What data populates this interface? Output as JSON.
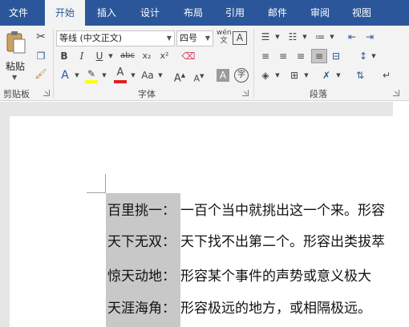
{
  "tabs": [
    {
      "label": "文件",
      "active": false
    },
    {
      "label": "开始",
      "active": true
    },
    {
      "label": "插入",
      "active": false
    },
    {
      "label": "设计",
      "active": false
    },
    {
      "label": "布局",
      "active": false
    },
    {
      "label": "引用",
      "active": false
    },
    {
      "label": "邮件",
      "active": false
    },
    {
      "label": "审阅",
      "active": false
    },
    {
      "label": "视图",
      "active": false
    }
  ],
  "clipboard": {
    "paste_label": "粘贴",
    "group_label": "剪贴板"
  },
  "font": {
    "font_name": "等线 (中文正文)",
    "font_size": "四号",
    "pinyin_label": "wén",
    "group_label": "字体",
    "bold": "B",
    "italic": "I",
    "underline": "U",
    "strike": "abc",
    "subscript": "x₂",
    "superscript": "x²",
    "change_case": "Aa",
    "grow": "A",
    "shrink": "A",
    "char_shade": "A",
    "enclose": "字"
  },
  "paragraph": {
    "group_label": "段落"
  },
  "colors": {
    "ribbon_tab_bg": "#2b579a",
    "font_color": "#e02020",
    "highlight": "#ffff00"
  },
  "document": {
    "lines": [
      {
        "term": "百里挑一：",
        "text": "一百个当中就挑出这一个来。形容"
      },
      {
        "term": "天下无双：",
        "text": "天下找不出第二个。形容出类拔萃"
      },
      {
        "term": "惊天动地：",
        "text": "形容某个事件的声势或意义极大"
      },
      {
        "term": "天涯海角：",
        "text": "形容极远的地方，或相隔极远。"
      }
    ]
  }
}
